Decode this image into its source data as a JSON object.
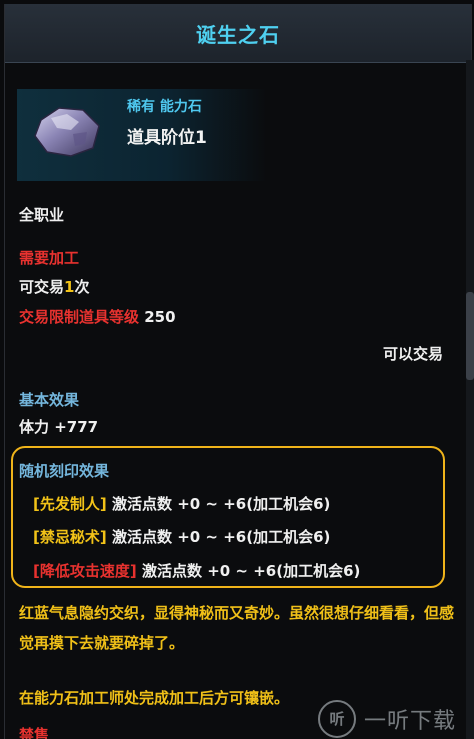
{
  "tooltip": {
    "title": "诞生之石",
    "rarity": "稀有 能力石",
    "tier": "道具阶位1",
    "class": "全职业",
    "requires_processing": "需要加工",
    "trade_prefix": "可交易",
    "trade_count": "1",
    "trade_suffix": "次",
    "trade_level_label": "交易限制道具等级",
    "trade_level_value": "250",
    "tradable": "可以交易",
    "base_effect_label": "基本效果",
    "base_effect_value": "体力 +777",
    "engrave_title": "随机刻印效果",
    "engravings": [
      {
        "name": "先发制人",
        "value": "激活点数 +0 ~ +6(加工机会6)",
        "color": "#f2c318"
      },
      {
        "name": "禁忌秘术",
        "value": "激活点数 +0 ~ +6(加工机会6)",
        "color": "#f2c318"
      },
      {
        "name": "降低攻击速度",
        "value": "激活点数 +0 ~ +6(加工机会6)",
        "color": "#e8322f"
      }
    ],
    "description": "红蓝气息隐约交织，显得神秘而又奇妙。虽然很想仔细看看，但感觉再摸下去就要碎掉了。",
    "note": "在能力石加工师处完成加工后方可镶嵌。",
    "sale_label": "禁售"
  },
  "watermark": {
    "icon_text": "听",
    "text": "一听下载"
  },
  "colors": {
    "title": "#4fd0f0",
    "yellow": "#f2c318",
    "red": "#e8322f",
    "blue": "#74b6dc",
    "highlight_border": "#f0b41a"
  }
}
